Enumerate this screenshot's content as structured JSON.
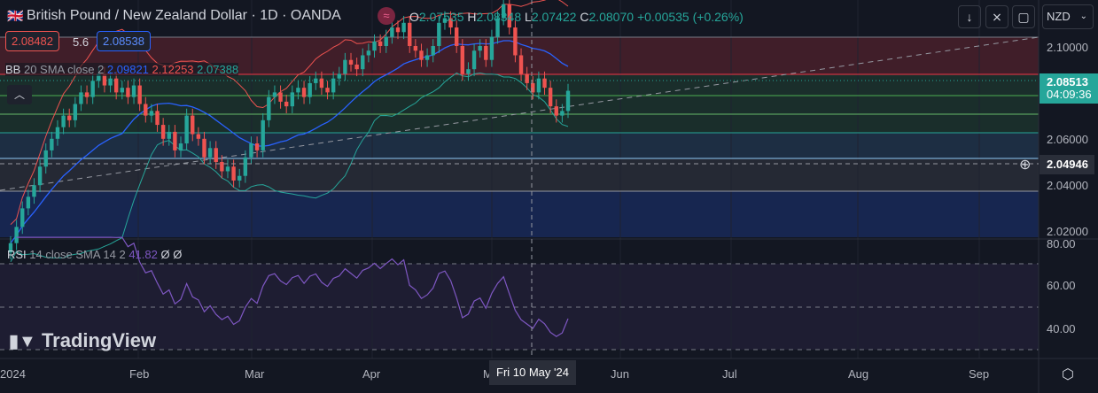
{
  "header": {
    "title": "British Pound / New Zealand Dollar · 1D · OANDA",
    "open_label": "O",
    "open": "2.07535",
    "high_label": "H",
    "high": "2.08348",
    "low_label": "L",
    "low": "2.07422",
    "close_label": "C",
    "close": "2.08070",
    "change": "+0.00535 (+0.26%)"
  },
  "trade": {
    "sell": "2.08482",
    "spread": "5.6",
    "buy": "2.08538"
  },
  "bb_legend": {
    "name": "BB",
    "params": "20 SMA close 2",
    "basis": "2.09821",
    "upper": "2.12253",
    "lower": "2.07388"
  },
  "rsi_legend": {
    "name": "RSI",
    "params": "14 close SMA 14 2",
    "value": "41.82",
    "v2": "Ø",
    "v3": "Ø"
  },
  "currency": "NZD",
  "price_axis": [
    "2.10000",
    "2.06000",
    "2.04000",
    "2.02000"
  ],
  "rsi_axis": [
    "80.00",
    "60.00",
    "40.00"
  ],
  "last_price": "2.08513",
  "countdown": "04:09:36",
  "crosshair_price": "2.04946",
  "time_axis": [
    "2024",
    "Feb",
    "Mar",
    "Apr",
    "M",
    "Jun",
    "Jul",
    "Aug",
    "Sep"
  ],
  "crosshair_date": "Fri 10 May '24",
  "logo": "TradingView",
  "colors": {
    "up": "#26a69a",
    "down": "#ef5350",
    "bb_basis": "#2962ff",
    "rsi": "#7e57c2"
  },
  "chart_data": {
    "type": "candlestick",
    "symbol": "GBPNZD",
    "timeframe": "1D",
    "closes": [
      2.015,
      2.022,
      2.03,
      2.035,
      2.04,
      2.048,
      2.055,
      2.06,
      2.065,
      2.07,
      2.068,
      2.075,
      2.08,
      2.078,
      2.085,
      2.088,
      2.083,
      2.086,
      2.08,
      2.082,
      2.078,
      2.083,
      2.075,
      2.07,
      2.072,
      2.066,
      2.06,
      2.063,
      2.055,
      2.058,
      2.07,
      2.062,
      2.06,
      2.052,
      2.056,
      2.05,
      2.046,
      2.048,
      2.042,
      2.044,
      2.052,
      2.058,
      2.055,
      2.068,
      2.078,
      2.08,
      2.076,
      2.074,
      2.08,
      2.082,
      2.078,
      2.084,
      2.086,
      2.082,
      2.08,
      2.086,
      2.088,
      2.094,
      2.092,
      2.09,
      2.096,
      2.098,
      2.102,
      2.1,
      2.104,
      2.108,
      2.106,
      2.11,
      2.1,
      2.098,
      2.094,
      2.096,
      2.1,
      2.11,
      2.112,
      2.108,
      2.1,
      2.088,
      2.09,
      2.098,
      2.1,
      2.094,
      2.104,
      2.112,
      2.118,
      2.108,
      2.096,
      2.088,
      2.084,
      2.08,
      2.086,
      2.082,
      2.074,
      2.07,
      2.072,
      2.0807
    ],
    "ylim": [
      2.015,
      2.12
    ],
    "rsi_ylim": [
      30,
      82
    ]
  }
}
